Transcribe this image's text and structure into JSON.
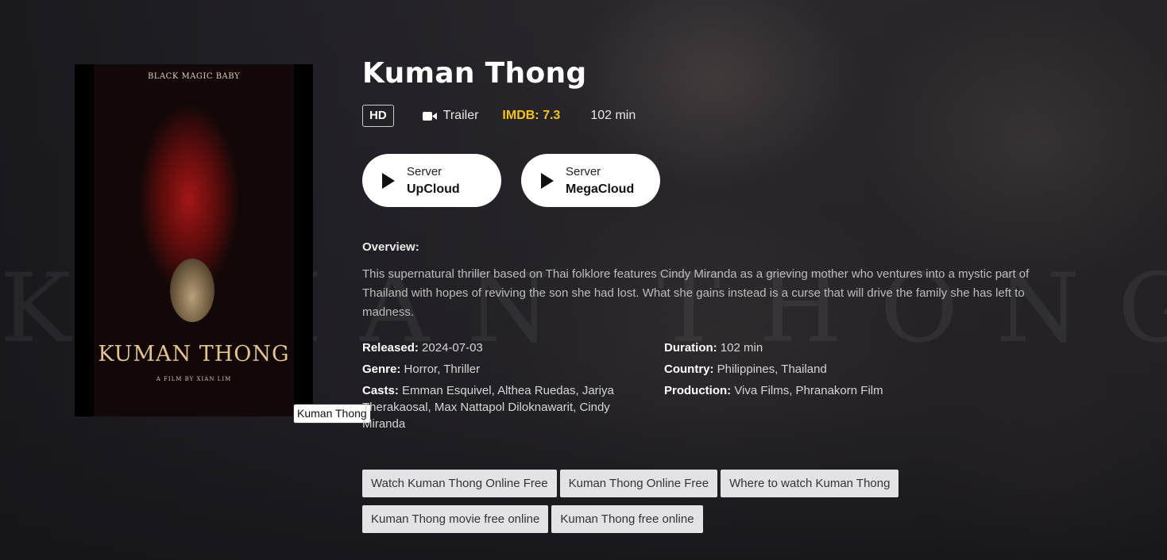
{
  "background": {
    "word": "KUMAN THONG"
  },
  "poster": {
    "tagline": "BLACK MAGIC BABY",
    "title": "KUMAN THONG",
    "credit": "A FILM BY XIAN LIM",
    "tooltip": "Kuman Thong"
  },
  "movie": {
    "title": "Kuman Thong",
    "quality": "HD",
    "trailer_label": "Trailer",
    "imdb": "IMDB: 7.3",
    "runtime": "102 min"
  },
  "servers": [
    {
      "small": "Server",
      "name": "UpCloud"
    },
    {
      "small": "Server",
      "name": "MegaCloud"
    }
  ],
  "overview": {
    "label": "Overview:",
    "text": "This supernatural thriller based on Thai folklore features Cindy Miranda as a grieving mother who ventures into a mystic part of Thailand with hopes of reviving the son she had lost. What she gains instead is a curse that will drive the family she has left to madness."
  },
  "details": {
    "released": {
      "label": "Released:",
      "value": "2024-07-03"
    },
    "genre": {
      "label": "Genre:",
      "value": "Horror, Thriller"
    },
    "casts": {
      "label": "Casts:",
      "value": "Emman Esquivel, Althea Ruedas, Jariya Therakaosal, Max Nattapol Diloknawarit, Cindy Miranda"
    },
    "duration": {
      "label": "Duration:",
      "value": "102 min"
    },
    "country": {
      "label": "Country:",
      "value": "Philippines, Thailand"
    },
    "production": {
      "label": "Production:",
      "value": "Viva Films, Phranakorn Film"
    }
  },
  "tags": [
    "Watch Kuman Thong Online Free",
    "Kuman Thong Online Free",
    "Where to watch Kuman Thong",
    "Kuman Thong movie free online",
    "Kuman Thong free online"
  ],
  "colors": {
    "imdb": "#f5c518",
    "background": "#141419",
    "tag_bg": "#e3e3e6"
  }
}
